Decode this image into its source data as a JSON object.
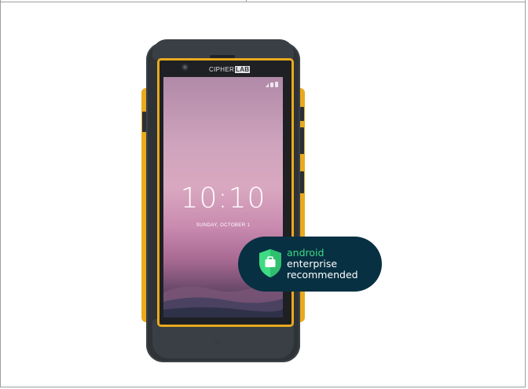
{
  "phone": {
    "brand_text": "CIPHER",
    "brand_box_text": "LAB",
    "lock_screen": {
      "time": "10:10",
      "date": "SUNDAY, OCTOBER 1"
    }
  },
  "badge": {
    "line1": "android",
    "line2": "enterprise",
    "line3": "recommended",
    "icon": "shield-briefcase-icon"
  },
  "colors": {
    "phone_accent": "#e9aa1e",
    "badge_bg": "#073042",
    "android_green": "#3ddc84"
  }
}
